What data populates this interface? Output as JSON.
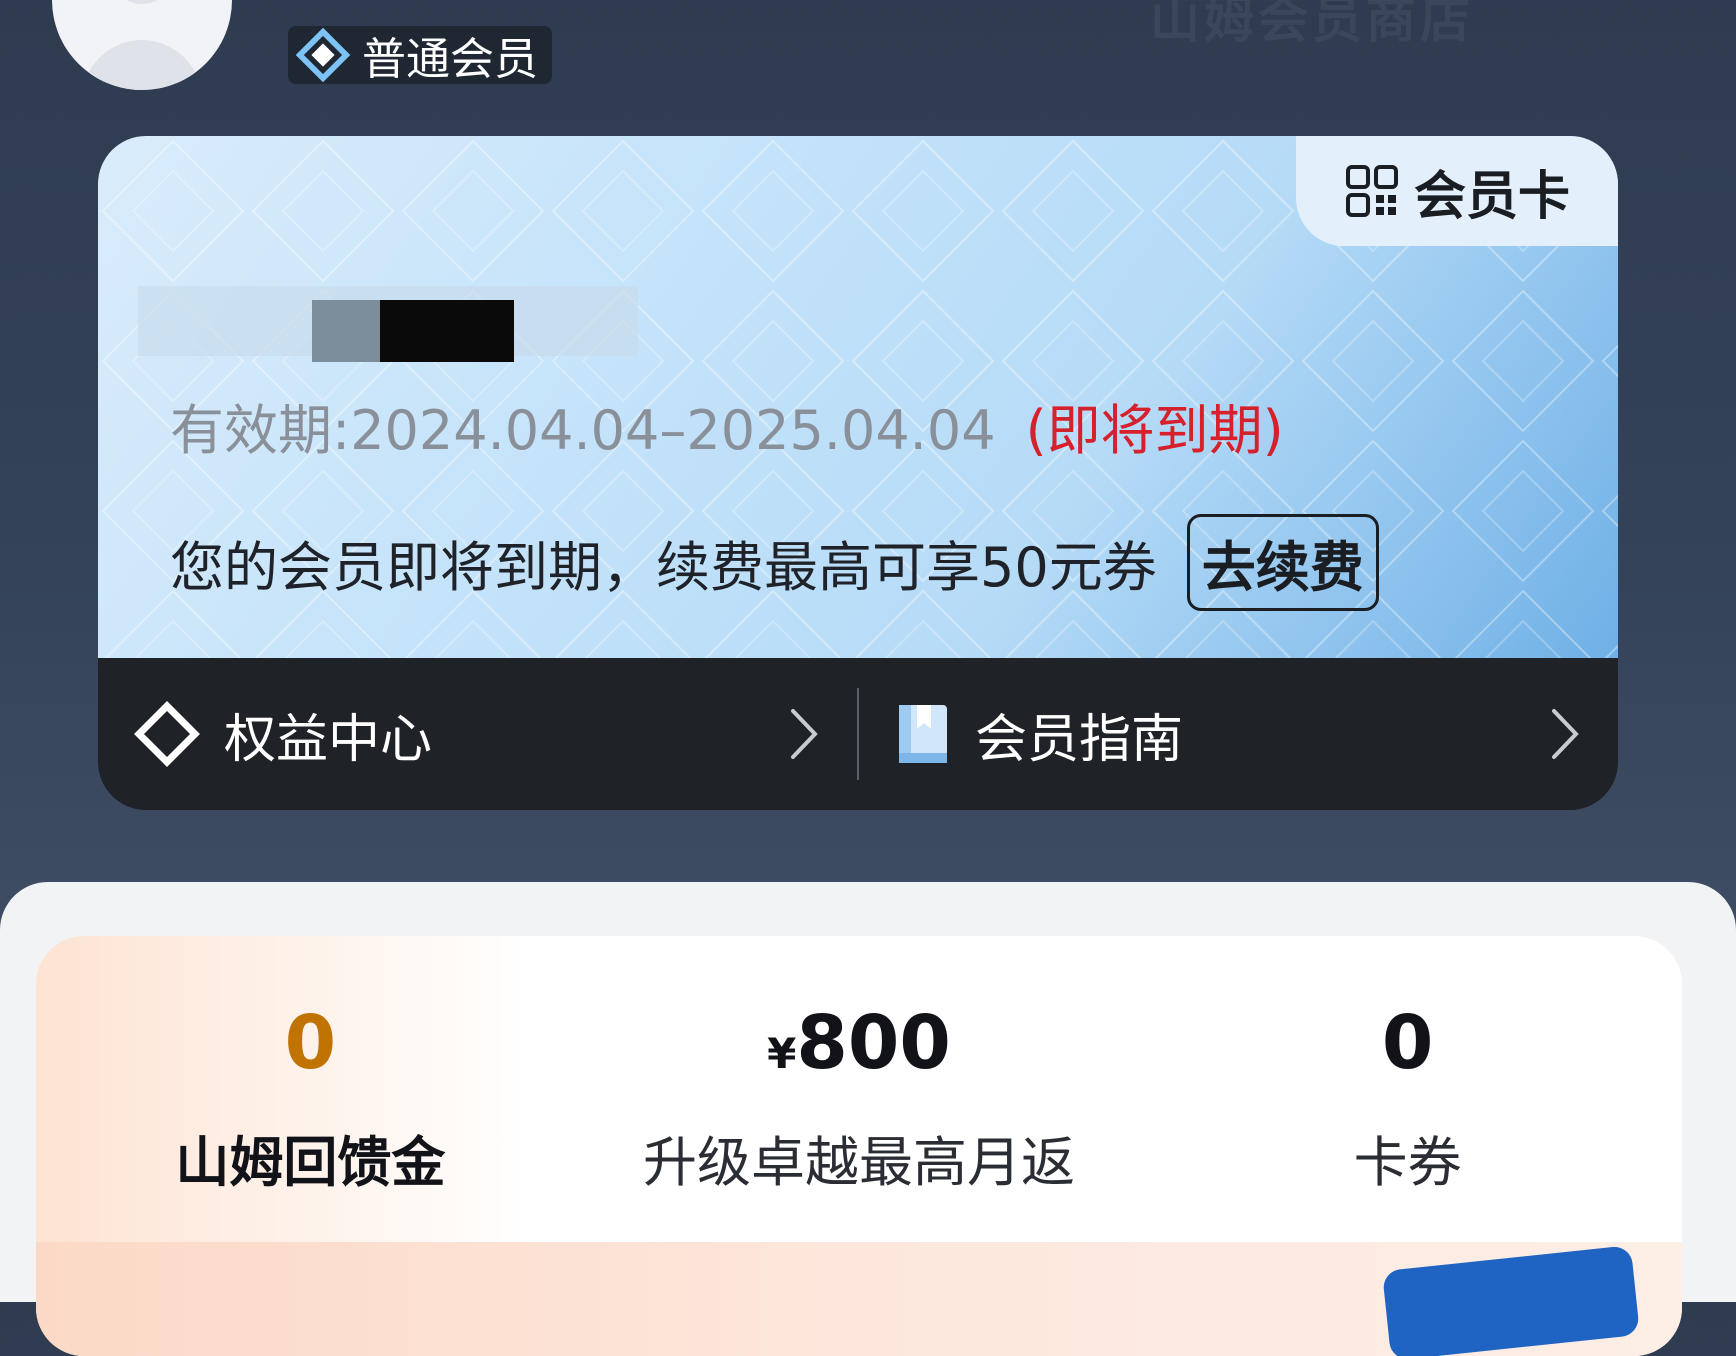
{
  "background_watermark": "山姆会员商店",
  "profile": {
    "member_level": "普通会员"
  },
  "card": {
    "tab_label": "会员卡",
    "validity_label": "有效期:2024.04.04–2025.04.04",
    "validity_warning": "(即将到期)",
    "renew_message": "您的会员即将到期，续费最高可享50元券",
    "renew_button": "去续费"
  },
  "card_nav": [
    {
      "label": "权益中心"
    },
    {
      "label": "会员指南"
    }
  ],
  "stats": [
    {
      "currency": "",
      "value": "0",
      "label": "山姆回馈金"
    },
    {
      "currency": "¥",
      "value": "800",
      "label": "升级卓越最高月返"
    },
    {
      "currency": "",
      "value": "0",
      "label": "卡券"
    }
  ],
  "colors": {
    "accent_gold": "#c07300",
    "warning_red": "#d6202c",
    "card_dark": "#1f2227"
  }
}
